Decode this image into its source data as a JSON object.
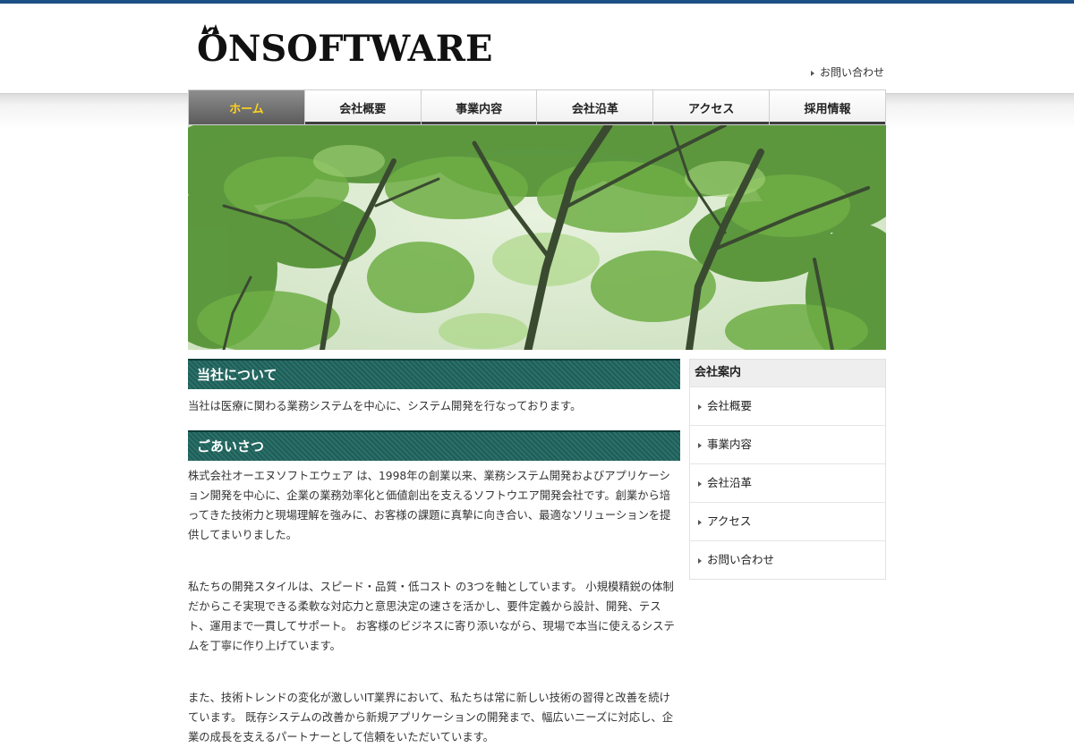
{
  "header": {
    "logo_text": "ÔNSOFTWARE",
    "contact_link": "お問い合わせ"
  },
  "nav": {
    "items": [
      {
        "label": "ホーム",
        "active": true
      },
      {
        "label": "会社概要"
      },
      {
        "label": "事業内容"
      },
      {
        "label": "会社沿革"
      },
      {
        "label": "アクセス"
      },
      {
        "label": "採用情報"
      }
    ]
  },
  "main": {
    "about_heading": "当社について",
    "about_text": "当社は医療に関わる業務システムを中心に、システム開発を行なっております。",
    "greeting_heading": "ごあいさつ",
    "greeting_p1": "株式会社オーエヌソフトエウェア は、1998年の創業以来、業務システム開発およびアプリケーション開発を中心に、企業の業務効率化と価値創出を支えるソフトウエア開発会社です。創業から培ってきた技術力と現場理解を強みに、お客様の課題に真摯に向き合い、最適なソリューションを提供してまいりました。",
    "greeting_p2": "私たちの開発スタイルは、スピード・品質・低コスト の3つを軸としています。 小規模精鋭の体制だからこそ実現できる柔軟な対応力と意思決定の速さを活かし、要件定義から設計、開発、テスト、運用まで一貫してサポート。 お客様のビジネスに寄り添いながら、現場で本当に使えるシステムを丁寧に作り上げています。",
    "greeting_p3": "また、技術トレンドの変化が激しいIT業界において、私たちは常に新しい技術の習得と改善を続けています。 既存システムの改善から新規アプリケーションの開発まで、幅広いニーズに対応し、企業の成長を支えるパートナーとして信頼をいただいています。"
  },
  "sidebar": {
    "heading": "会社案内",
    "items": [
      "会社概要",
      "事業内容",
      "会社沿革",
      "アクセス",
      "お問い合わせ"
    ]
  },
  "colors": {
    "top_rule": "#1c4f86",
    "section_head": "#2c7069",
    "nav_active_text": "#ffd21f"
  },
  "hero": {
    "image_subject": "green-forest-canopy"
  }
}
